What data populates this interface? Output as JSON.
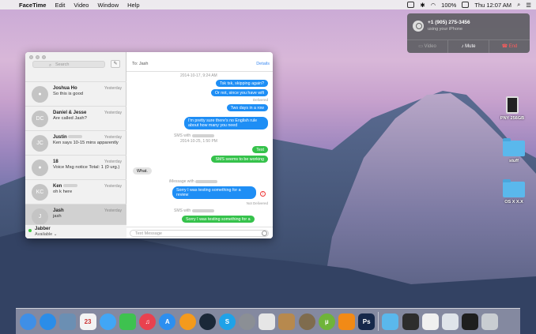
{
  "menubar": {
    "app_name": "FaceTime",
    "menus": [
      "Edit",
      "Video",
      "Window",
      "Help"
    ],
    "battery": "100%",
    "clock": "Thu 12:07 AM"
  },
  "notification": {
    "caller": "+1 (905) 275-3456",
    "subtitle": "using your iPhone",
    "video_label": "Video",
    "mute_label": "Mute",
    "end_label": "End"
  },
  "desktop": {
    "items": [
      {
        "label": "PNY 256GB",
        "kind": "sd-card"
      },
      {
        "label": "stuff",
        "kind": "folder"
      },
      {
        "label": "OS X X.X",
        "kind": "folder"
      }
    ]
  },
  "messages": {
    "search_placeholder": "Search",
    "conversations": [
      {
        "name": "Joshua Ho",
        "time": "Yesterday",
        "preview": "So this is good",
        "initials": ""
      },
      {
        "name": "Daniel & Jesse",
        "time": "Yesterday",
        "preview": "Are called Jash?",
        "initials": "DC"
      },
      {
        "name": "Justin",
        "time": "Yesterday",
        "preview": "Ken says 10-15 mins apparently",
        "initials": "JC"
      },
      {
        "name": "18",
        "time": "Yesterday",
        "preview": "Voice    Msg notice Total: 1 (0 urg.)",
        "initials": ""
      },
      {
        "name": "Ken",
        "time": "Yesterday",
        "preview": "oh k here",
        "initials": "KC"
      },
      {
        "name": "Jash",
        "time": "Yesterday",
        "preview": "jash",
        "initials": "J"
      }
    ],
    "account": {
      "name": "Jabber",
      "status": "Available"
    },
    "chat": {
      "to_label": "To:",
      "to_name": "Jash",
      "details_label": "Details",
      "input_placeholder": "Text Message",
      "stamp1": "2014-10-17, 9:24 AM",
      "msg1": "Tsk tsk, skipping again?",
      "msg2": "Or not, since you have wifi",
      "delivered": "Delivered",
      "msg3": "Two days in a row",
      "msg4": "I'm pretty sure there's no English rule about how many you need",
      "sms_label": "SMS with",
      "stamp2": "2014-10-25, 1:50 PM",
      "msg5": "Test",
      "msg6": "SMS seems to be working",
      "msg7": "What.",
      "imessage_label": "iMessage with",
      "msg8": "Sorry I was testing something for a review",
      "not_delivered": "Not Delivered",
      "sms_label2": "SMS with",
      "msg9": "Sorry I was testing something for a"
    }
  },
  "dock": {
    "icons": [
      {
        "name": "finder",
        "color": "#3f8fe6",
        "glyph": ""
      },
      {
        "name": "safari",
        "color": "#2b8de8",
        "glyph": ""
      },
      {
        "name": "preview",
        "color": "#6b8fb3",
        "glyph": ""
      },
      {
        "name": "calendar",
        "color": "#f3f3f3",
        "glyph": "23"
      },
      {
        "name": "messages",
        "color": "#41a6f5",
        "glyph": ""
      },
      {
        "name": "facetime",
        "color": "#3ec24f",
        "glyph": ""
      },
      {
        "name": "itunes",
        "color": "#e9424f",
        "glyph": "♫"
      },
      {
        "name": "app-store",
        "color": "#2c8ff0",
        "glyph": "A"
      },
      {
        "name": "ibooks",
        "color": "#f49a1c",
        "glyph": ""
      },
      {
        "name": "steam",
        "color": "#1b2838",
        "glyph": ""
      },
      {
        "name": "skype",
        "color": "#1fa2e8",
        "glyph": "S"
      },
      {
        "name": "system-preferences",
        "color": "#8b8f95",
        "glyph": ""
      },
      {
        "name": "textedit",
        "color": "#e6e6e6",
        "glyph": ""
      },
      {
        "name": "cardhop",
        "color": "#b7894e",
        "glyph": ""
      },
      {
        "name": "photos",
        "color": "#7f6c4e",
        "glyph": ""
      },
      {
        "name": "utorrent",
        "color": "#6fb43a",
        "glyph": "µ"
      },
      {
        "name": "vlc",
        "color": "#f28a16",
        "glyph": ""
      },
      {
        "name": "photoshop",
        "color": "#16284a",
        "glyph": "Ps"
      },
      {
        "name": "downloads-folder",
        "color": "#5ab8ec",
        "glyph": ""
      },
      {
        "name": "sd-card",
        "color": "#2d2d2d",
        "glyph": ""
      },
      {
        "name": "preview-doc",
        "color": "#f0f0f0",
        "glyph": ""
      },
      {
        "name": "screenshots",
        "color": "#dfe4ea",
        "glyph": ""
      },
      {
        "name": "terminal",
        "color": "#1e1e1e",
        "glyph": ""
      },
      {
        "name": "trash",
        "color": "#c9cdd2",
        "glyph": ""
      }
    ]
  }
}
